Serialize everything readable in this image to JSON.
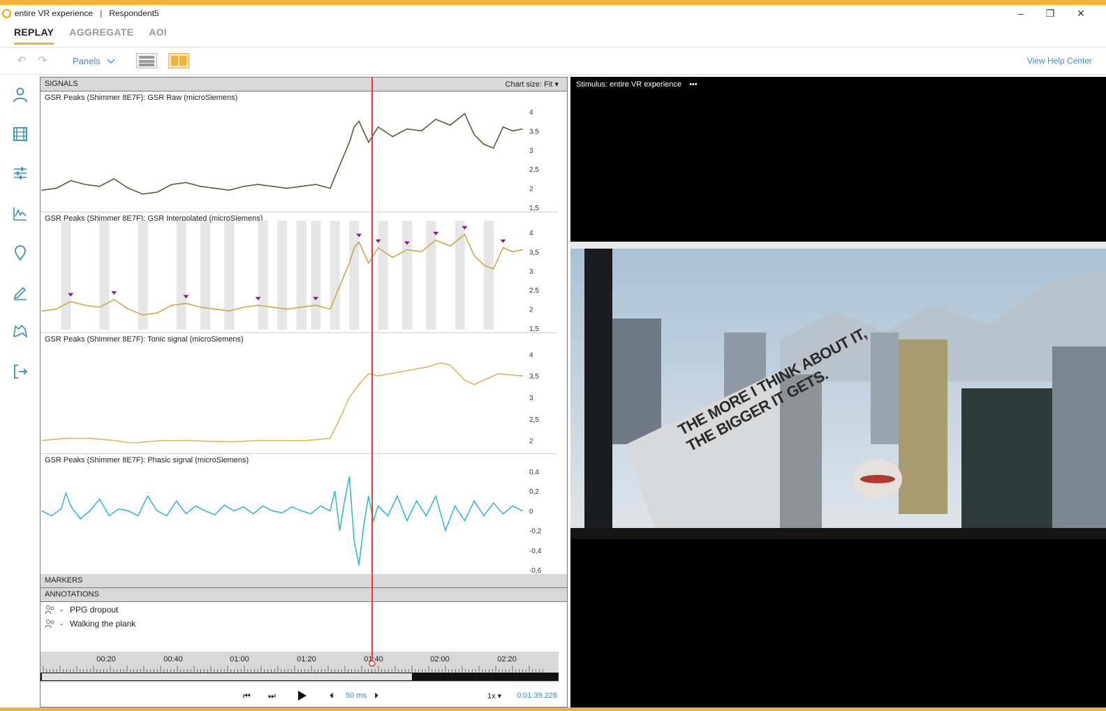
{
  "window": {
    "title": "entire VR experience",
    "respondent": "Respondent5",
    "minimize": "–",
    "restore": "❐",
    "close": "✕"
  },
  "nav_tabs": [
    {
      "label": "REPLAY",
      "active": true
    },
    {
      "label": "AGGREGATE",
      "active": false
    },
    {
      "label": "AOI",
      "active": false
    }
  ],
  "toolbar": {
    "undo": "↶",
    "redo": "↷",
    "panels_label": "Panels",
    "help_label": "View Help Center"
  },
  "signals": {
    "header": "SIGNALS",
    "chart_size_label": "Chart size:",
    "chart_size_value": "Fit"
  },
  "markers_header": "MARKERS",
  "annotations": {
    "header": "ANNOTATIONS",
    "items": [
      {
        "dash": "-",
        "label": "PPG dropout"
      },
      {
        "dash": "-",
        "label": "Walking the plank"
      }
    ]
  },
  "timeline": {
    "labels": [
      "00:20",
      "00:40",
      "01:00",
      "01:20",
      "01:40",
      "02:00",
      "02:20"
    ]
  },
  "playback": {
    "step": "50 ms",
    "speed": "1x",
    "timecode": "0:01:39.226"
  },
  "stimulus": {
    "label": "Stimulus: entire VR experience",
    "more": "•••",
    "billboard_line1": "THE MORE I THINK ABOUT IT,",
    "billboard_line2": "THE BIGGER IT GETS."
  },
  "colors": {
    "accent": "#f0b23a",
    "link": "#3a8fb7",
    "cursor": "#e53935",
    "gsr_raw": "#5a5a3a",
    "gsr_interp": "#c9a84c",
    "tonic": "#d4b866",
    "phasic": "#3ab8d0",
    "peak_marker": "#8b1a8b"
  },
  "chart_data": [
    {
      "type": "line",
      "title": "GSR Peaks (Shimmer 8E7F): GSR Raw (microSiemens)",
      "yticks": [
        "4",
        "3,5",
        "3",
        "2,5",
        "2",
        "1,5"
      ],
      "ylim": [
        1.5,
        4.2
      ],
      "xlim": [
        0,
        100
      ],
      "x": [
        0,
        3,
        6,
        9,
        12,
        15,
        18,
        21,
        24,
        27,
        30,
        33,
        36,
        39,
        42,
        45,
        48,
        51,
        54,
        57,
        60,
        62,
        64,
        65,
        66,
        68,
        70,
        73,
        76,
        79,
        82,
        85,
        88,
        90,
        92,
        94,
        96,
        98,
        100
      ],
      "y": [
        1.95,
        2.0,
        2.2,
        2.1,
        2.05,
        2.25,
        2.0,
        1.85,
        1.9,
        2.1,
        2.15,
        2.05,
        2.0,
        1.95,
        2.05,
        2.1,
        2.05,
        2.0,
        2.05,
        2.1,
        2.0,
        2.6,
        3.2,
        3.6,
        3.75,
        3.2,
        3.6,
        3.35,
        3.55,
        3.5,
        3.8,
        3.65,
        3.95,
        3.4,
        3.15,
        3.05,
        3.6,
        3.5,
        3.55
      ]
    },
    {
      "type": "line",
      "title": "GSR Peaks (Shimmer 8E7F): GSR Interpolated (microSiemens)",
      "yticks": [
        "4",
        "3,5",
        "3",
        "2,5",
        "2",
        "1,5"
      ],
      "ylim": [
        1.5,
        4.2
      ],
      "xlim": [
        0,
        100
      ],
      "x": [
        0,
        3,
        6,
        9,
        12,
        15,
        18,
        21,
        24,
        27,
        30,
        33,
        36,
        39,
        42,
        45,
        48,
        51,
        54,
        57,
        60,
        62,
        64,
        65,
        66,
        68,
        70,
        73,
        76,
        79,
        82,
        85,
        88,
        90,
        92,
        94,
        96,
        98,
        100
      ],
      "y": [
        1.95,
        2.0,
        2.2,
        2.1,
        2.05,
        2.25,
        2.0,
        1.85,
        1.9,
        2.1,
        2.15,
        2.05,
        2.0,
        1.95,
        2.05,
        2.1,
        2.05,
        2.0,
        2.05,
        2.1,
        2.0,
        2.6,
        3.2,
        3.6,
        3.75,
        3.2,
        3.6,
        3.35,
        3.55,
        3.5,
        3.8,
        3.65,
        3.95,
        3.4,
        3.15,
        3.05,
        3.6,
        3.5,
        3.55
      ]
    },
    {
      "type": "line",
      "title": "GSR Peaks (Shimmer 8E7F): Tonic signal (microSiemens)",
      "yticks": [
        "4",
        "3,5",
        "3",
        "2,5",
        "2"
      ],
      "ylim": [
        1.8,
        4.2
      ],
      "xlim": [
        0,
        100
      ],
      "x": [
        0,
        5,
        10,
        15,
        18,
        20,
        25,
        30,
        35,
        40,
        45,
        50,
        55,
        60,
        62,
        64,
        66,
        68,
        70,
        75,
        80,
        83,
        85,
        88,
        90,
        92,
        95,
        100
      ],
      "y": [
        2.0,
        2.05,
        2.05,
        2.0,
        1.95,
        1.95,
        2.0,
        2.0,
        1.98,
        1.97,
        2.0,
        2.0,
        2.0,
        2.05,
        2.5,
        3.0,
        3.3,
        3.55,
        3.5,
        3.6,
        3.7,
        3.8,
        3.75,
        3.4,
        3.3,
        3.4,
        3.55,
        3.5
      ]
    },
    {
      "type": "line",
      "title": "GSR Peaks (Shimmer 8E7F): Phasic signal (microSiemens)",
      "yticks": [
        "0,4",
        "0,2",
        "0",
        "-0,2",
        "-0,4",
        "-0,6"
      ],
      "ylim": [
        -0.6,
        0.45
      ],
      "xlim": [
        0,
        100
      ],
      "x": [
        0,
        2,
        4,
        5,
        6,
        8,
        10,
        12,
        14,
        16,
        18,
        20,
        22,
        24,
        26,
        28,
        30,
        32,
        34,
        36,
        38,
        40,
        42,
        44,
        46,
        48,
        50,
        52,
        54,
        56,
        58,
        60,
        61,
        62,
        63,
        64,
        65,
        66,
        67,
        68,
        69,
        70,
        72,
        74,
        76,
        78,
        80,
        82,
        84,
        86,
        88,
        90,
        92,
        94,
        96,
        98,
        100
      ],
      "y": [
        0.0,
        -0.05,
        0.02,
        0.18,
        0.05,
        -0.08,
        0.0,
        0.12,
        -0.05,
        0.02,
        0.0,
        -0.05,
        0.15,
        0.0,
        -0.05,
        0.1,
        -0.03,
        0.05,
        0.0,
        -0.04,
        0.06,
        0.0,
        0.04,
        -0.03,
        0.05,
        0.0,
        -0.02,
        0.04,
        0.0,
        -0.03,
        0.05,
        0.0,
        0.2,
        -0.2,
        0.1,
        0.35,
        -0.3,
        -0.55,
        -0.15,
        0.15,
        -0.1,
        0.05,
        -0.05,
        0.15,
        -0.1,
        0.1,
        -0.05,
        0.15,
        -0.2,
        0.05,
        -0.1,
        0.1,
        -0.05,
        0.08,
        -0.03,
        0.05,
        0.0
      ]
    }
  ]
}
